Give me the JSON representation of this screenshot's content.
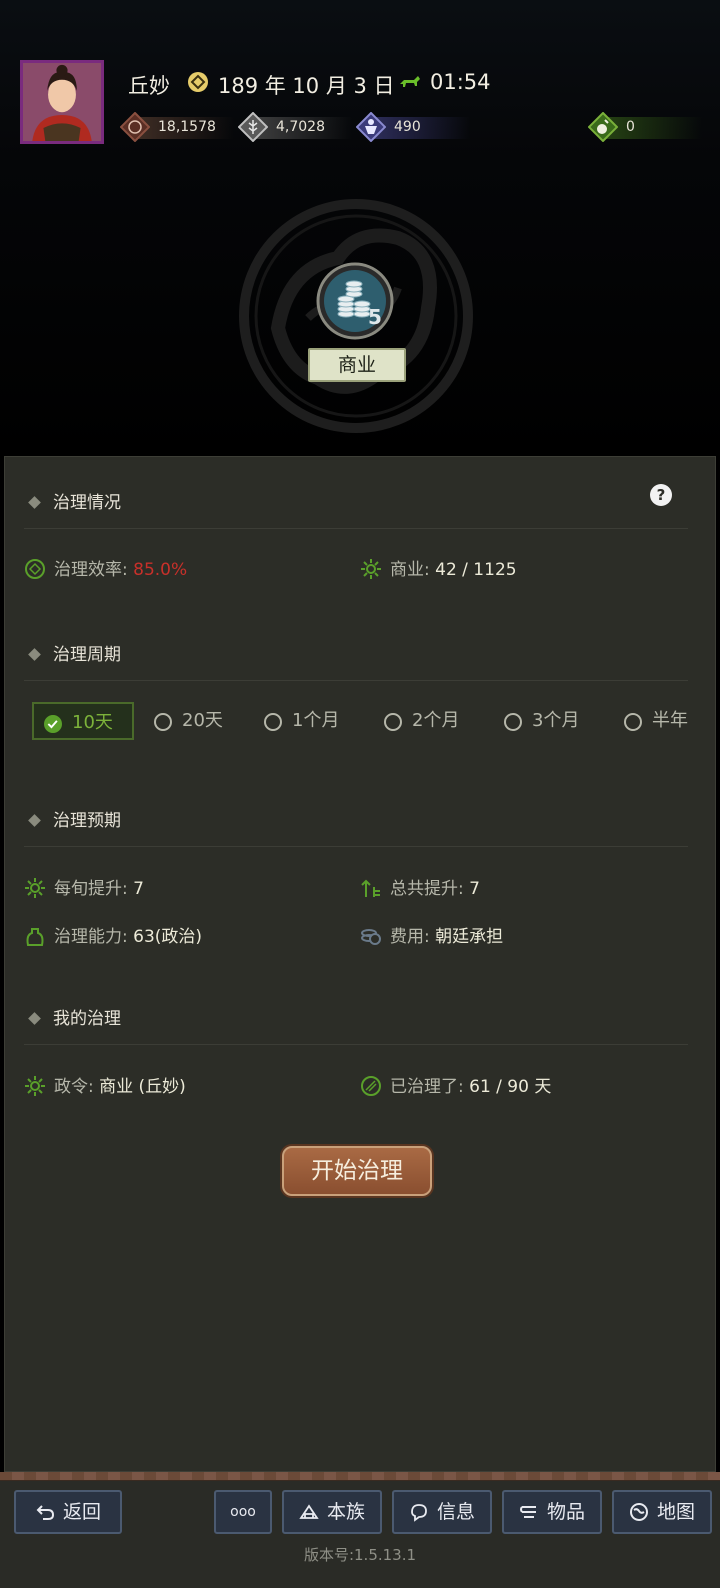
{
  "header": {
    "player_name": "丘妙",
    "date": "189 年 10 月 3 日",
    "time": "01:54",
    "resources": {
      "gold": "18,1578",
      "food": "4,7028",
      "troops": "490",
      "special": "0"
    }
  },
  "city_emblem": {
    "coin_count": "5",
    "title": "商业"
  },
  "status": {
    "heading": "治理情况",
    "help": "?",
    "efficiency_label": "治理效率:",
    "efficiency_value": "85.0%",
    "commerce_label": "商业:",
    "commerce_value": "42 / 1125"
  },
  "period": {
    "heading": "治理周期",
    "options": [
      "10天",
      "20天",
      "1个月",
      "2个月",
      "3个月",
      "半年"
    ],
    "selected": "10天"
  },
  "expected": {
    "heading": "治理预期",
    "per_xun_label": "每旬提升:",
    "per_xun_value": "7",
    "total_label": "总共提升:",
    "total_value": "7",
    "ability_label": "治理能力:",
    "ability_value": "63(政治)",
    "cost_label": "费用:",
    "cost_value": "朝廷承担"
  },
  "mine": {
    "heading": "我的治理",
    "order_label": "政令:",
    "order_value": "商业 (丘妙)",
    "days_label": "已治理了:",
    "days_value": "61 / 90 天"
  },
  "start_button": "开始治理",
  "nav": {
    "back": "返回",
    "more": "ooo",
    "clan": "本族",
    "info": "信息",
    "items": "物品",
    "map": "地图"
  },
  "version": "版本号:1.5.13.1",
  "colors": {
    "efficiency_red": "#c8302a",
    "selected_green": "#7cb23a",
    "panel_bg": "#2c2d27",
    "button_brown": "#9a5c3a"
  }
}
